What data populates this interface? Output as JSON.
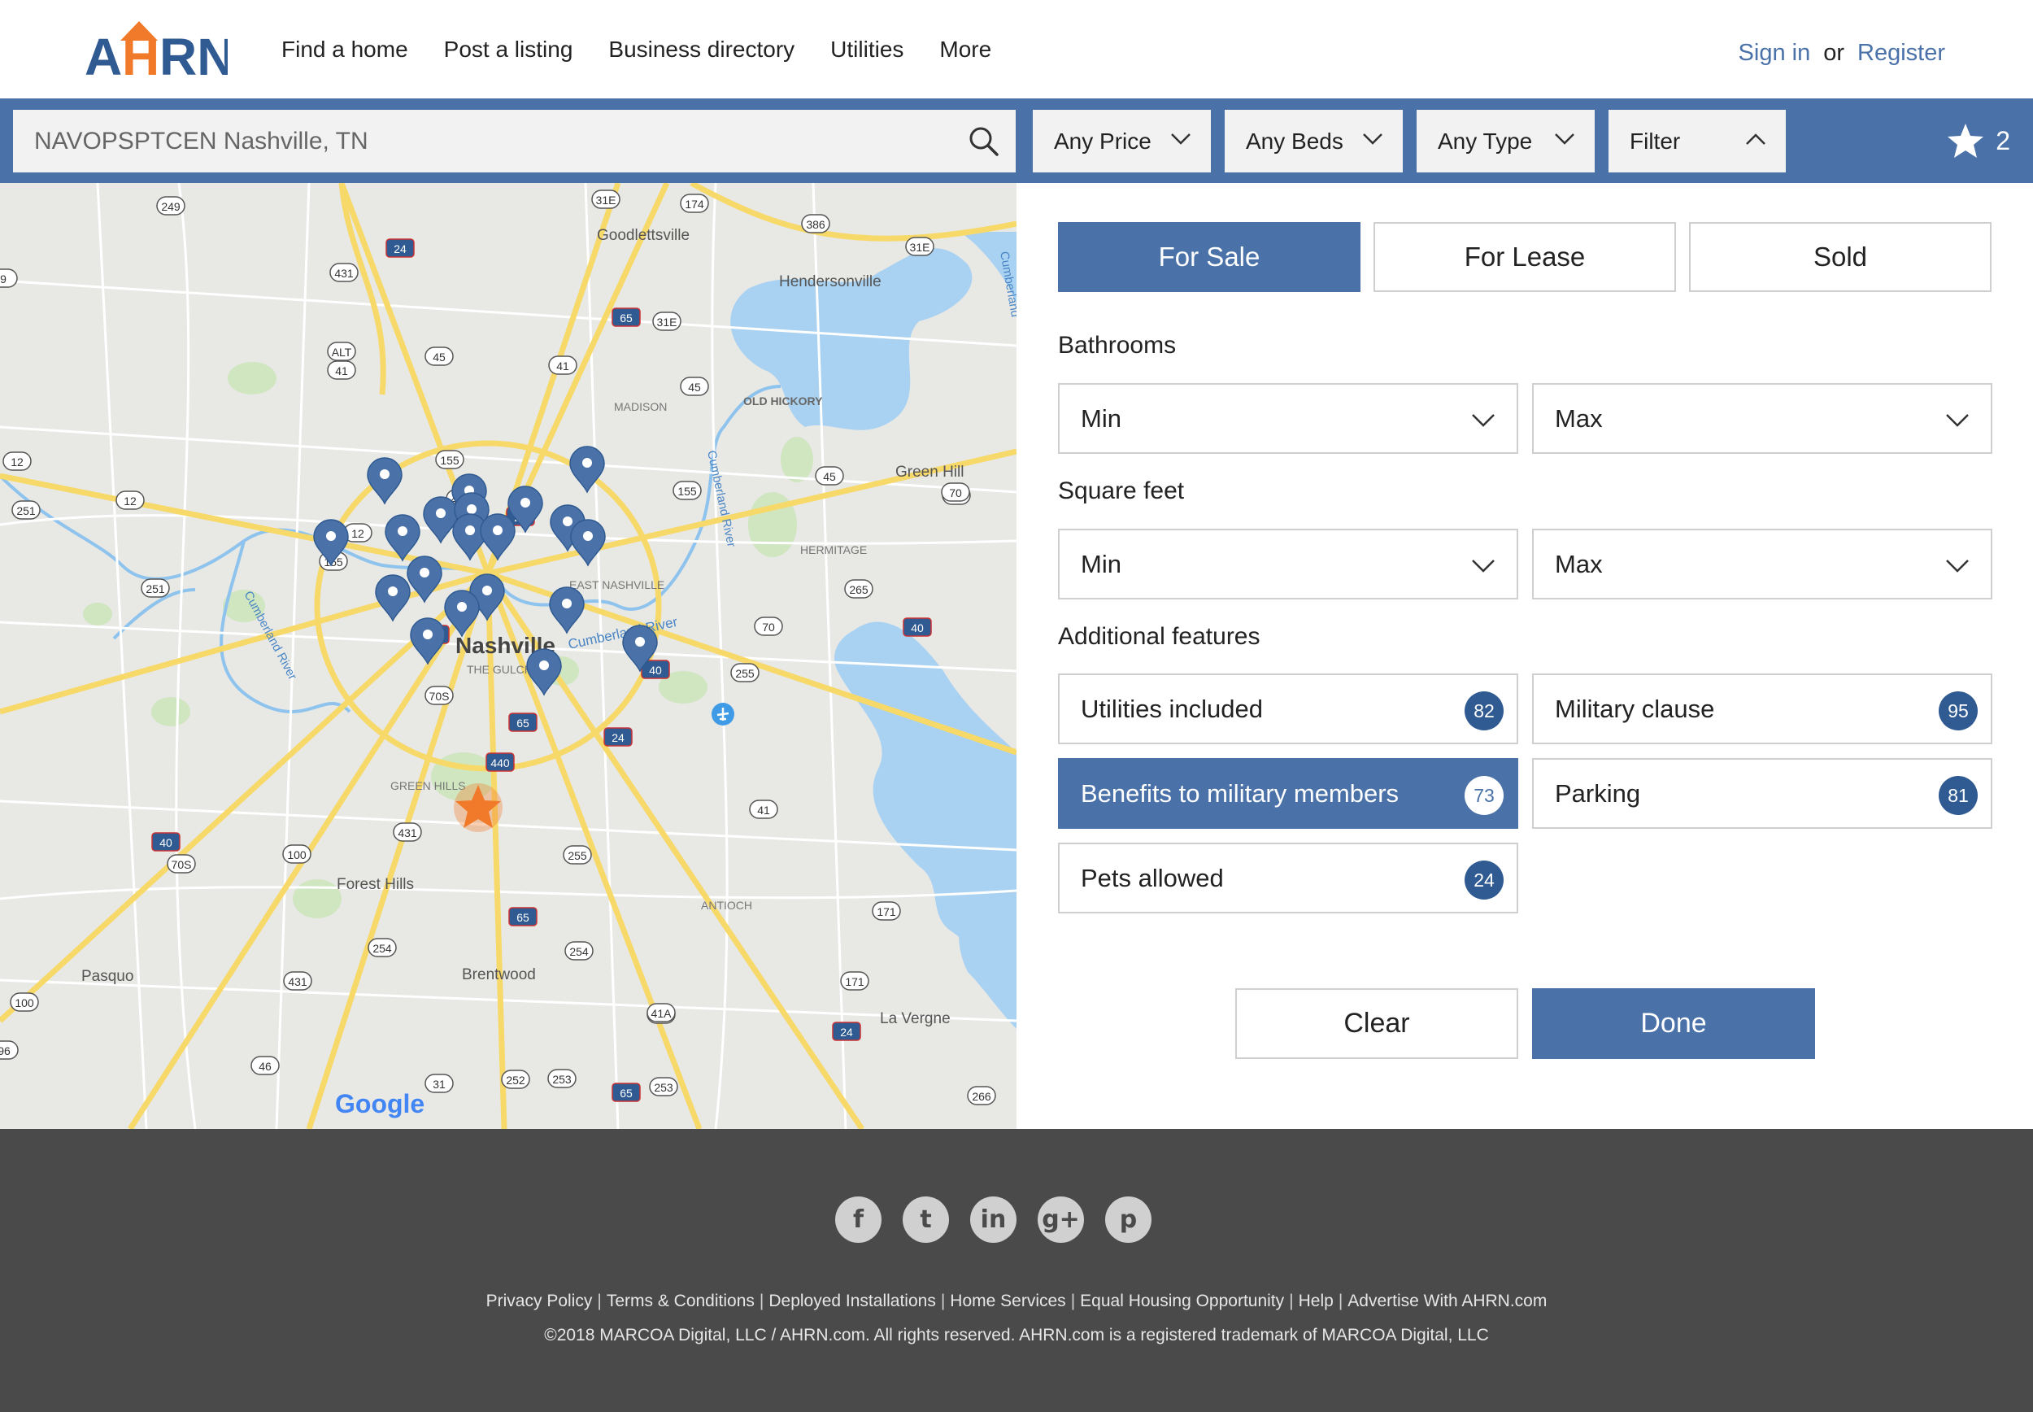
{
  "header": {
    "logo_text": "AHRN",
    "nav": [
      "Find a home",
      "Post a listing",
      "Business directory",
      "Utilities",
      "More"
    ],
    "sign_in": "Sign in",
    "or": "or",
    "register": "Register"
  },
  "search": {
    "value": "NAVOPSPTCEN Nashville, TN",
    "placeholder": "",
    "price": "Any Price",
    "beds": "Any Beds",
    "type": "Any Type",
    "filter": "Filter",
    "favorites_count": "2"
  },
  "map": {
    "city": "Nashville",
    "places": [
      "Goodlettsville",
      "Hendersonville",
      "MADISON",
      "OLD HICKORY",
      "Green Hill",
      "HERMITAGE",
      "EAST NASHVILLE",
      "THE GULCH",
      "GREEN HILLS",
      "Forest Hills",
      "ANTIOCH",
      "Brentwood",
      "La Vergne",
      "Pasquo"
    ],
    "rivers": [
      "Cumberland River",
      "Cumberland River",
      "Cumberland River",
      "Cumberland"
    ],
    "brand": "Google",
    "shields": [
      "249",
      "24",
      "431",
      "ALT",
      "41",
      "45",
      "41",
      "155",
      "431",
      "24",
      "12",
      "12",
      "251",
      "155",
      "251",
      "40",
      "70S",
      "65",
      "440",
      "431",
      "40",
      "70S",
      "100",
      "65",
      "254",
      "254",
      "431",
      "100",
      "46",
      "31",
      "252",
      "253",
      "253",
      "41A",
      "171",
      "171",
      "24",
      "266",
      "255",
      "70",
      "255",
      "40",
      "24",
      "41",
      "265",
      "70",
      "40",
      "65",
      "174",
      "386",
      "31E",
      "65",
      "31E",
      "45",
      "155",
      "45",
      "70",
      "31E",
      "9",
      "96",
      "12",
      "41A"
    ]
  },
  "filters": {
    "listing_types": [
      {
        "label": "For Sale",
        "active": true
      },
      {
        "label": "For Lease",
        "active": false
      },
      {
        "label": "Sold",
        "active": false
      }
    ],
    "bathrooms_label": "Bathrooms",
    "bath_min": "Min",
    "bath_max": "Max",
    "sqft_label": "Square feet",
    "sqft_min": "Min",
    "sqft_max": "Max",
    "features_label": "Additional features",
    "features": [
      {
        "label": "Utilities included",
        "count": "82",
        "active": false
      },
      {
        "label": "Military clause",
        "count": "95",
        "active": false
      },
      {
        "label": "Benefits to military members",
        "count": "73",
        "active": true
      },
      {
        "label": "Parking",
        "count": "81",
        "active": false
      },
      {
        "label": "Pets allowed",
        "count": "24",
        "active": false
      }
    ],
    "clear": "Clear",
    "done": "Done"
  },
  "footer": {
    "social_icons": [
      "facebook-icon",
      "twitter-icon",
      "linkedin-icon",
      "google-plus-icon",
      "pinterest-icon"
    ],
    "social_glyphs": [
      "f",
      "t",
      "in",
      "g+",
      "p"
    ],
    "links": [
      "Privacy Policy",
      "Terms & Conditions",
      "Deployed Installations",
      "Home Services",
      "Equal Housing Opportunity",
      "Help",
      "Advertise With AHRN.com"
    ],
    "copyright": "©2018 MARCOA Digital, LLC / AHRN.com. All rights reserved. AHRN.com is a registered trademark of MARCOA Digital, LLC"
  },
  "colors": {
    "brand_blue": "#4a72a8",
    "badge_blue": "#2f5a92",
    "logo_orange": "#f07a2a",
    "footer_bg": "#4a4a4a"
  }
}
